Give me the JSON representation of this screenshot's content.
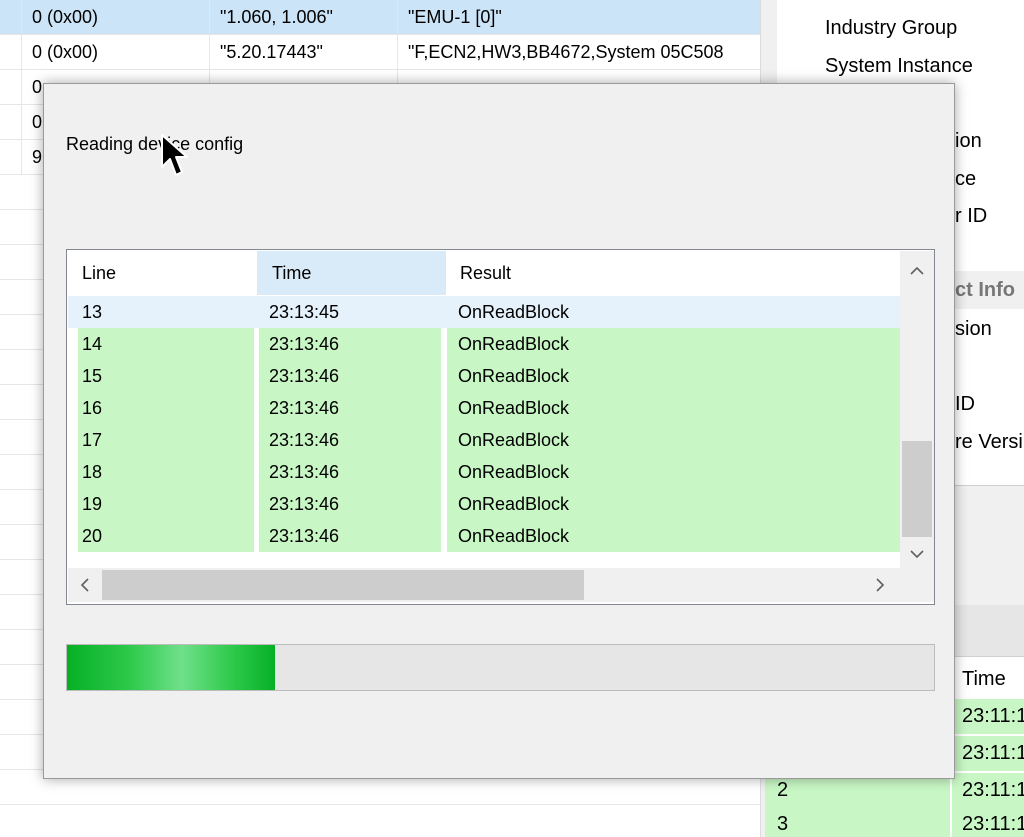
{
  "background_table": {
    "rows": [
      {
        "col0": "",
        "col1": "0 (0x00)",
        "col2": "\"1.060, 1.006\"",
        "col3": "\"EMU-1 [0]\"",
        "selected": true
      },
      {
        "col0": "",
        "col1": "0 (0x00)",
        "col2": "\"5.20.17443\"",
        "col3": "\"F,ECN2,HW3,BB4672,System 05C508"
      },
      {
        "col0": "",
        "col1": "0",
        "col2": "",
        "col3": ""
      },
      {
        "col0": "",
        "col1": "0",
        "col2": "",
        "col3": ""
      },
      {
        "col0": "",
        "col1": "9",
        "col2": "",
        "col3": ""
      }
    ]
  },
  "properties": {
    "items": [
      "Industry Group",
      "System Instance",
      "ion",
      "ce",
      "r ID",
      "ct Info",
      "sion",
      "ID",
      "re Versi"
    ]
  },
  "log_panel": {
    "column_time": "Time",
    "rows": [
      {
        "index": "",
        "time": "23:11:1"
      },
      {
        "index": "",
        "time": "23:11:1"
      },
      {
        "index": "2",
        "time": "23:11:1"
      },
      {
        "index": "3",
        "time": "23:11:1"
      }
    ]
  },
  "dialog": {
    "status": "Reading device config",
    "columns": {
      "line": "Line",
      "time": "Time",
      "result": "Result"
    },
    "rows": [
      {
        "line": "13",
        "time": "23:13:45",
        "result": "OnReadBlock",
        "state": "hot"
      },
      {
        "line": "14",
        "time": "23:13:46",
        "result": "OnReadBlock",
        "state": "ok"
      },
      {
        "line": "15",
        "time": "23:13:46",
        "result": "OnReadBlock",
        "state": "ok"
      },
      {
        "line": "16",
        "time": "23:13:46",
        "result": "OnReadBlock",
        "state": "ok"
      },
      {
        "line": "17",
        "time": "23:13:46",
        "result": "OnReadBlock",
        "state": "ok"
      },
      {
        "line": "18",
        "time": "23:13:46",
        "result": "OnReadBlock",
        "state": "ok"
      },
      {
        "line": "19",
        "time": "23:13:46",
        "result": "OnReadBlock",
        "state": "ok"
      },
      {
        "line": "20",
        "time": "23:13:46",
        "result": "OnReadBlock",
        "state": "ok"
      }
    ],
    "progress_fraction": 0.24,
    "icons": {
      "scroll_up": "chevron-up-icon",
      "scroll_down": "chevron-down-icon",
      "scroll_left": "chevron-left-icon",
      "scroll_right": "chevron-right-icon",
      "cursor": "mouse-pointer-icon"
    }
  },
  "colors": {
    "selected_row": "#cce4f7",
    "success_row": "#c8f7c5",
    "progress_fill": "#06b025"
  }
}
